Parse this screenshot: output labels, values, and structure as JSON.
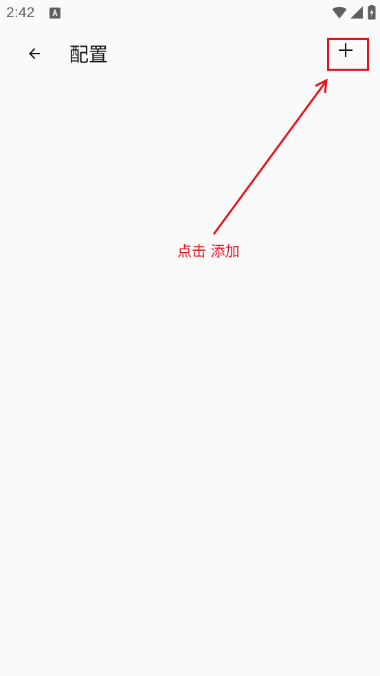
{
  "status_bar": {
    "time": "2:42",
    "notification_icon": "font-download-icon",
    "wifi_icon": "wifi-icon",
    "signal_icon": "cell-signal-icon",
    "battery_icon": "battery-charging-icon"
  },
  "app_bar": {
    "back_icon": "arrow-back-icon",
    "title": "配置",
    "add_icon": "plus-icon"
  },
  "annotation": {
    "text": "点击 添加",
    "color": "#e5111b"
  },
  "colors": {
    "background": "#fafafa",
    "status_text": "#5f5f5f",
    "title_text": "#111111",
    "annotation_red": "#e5111b"
  }
}
